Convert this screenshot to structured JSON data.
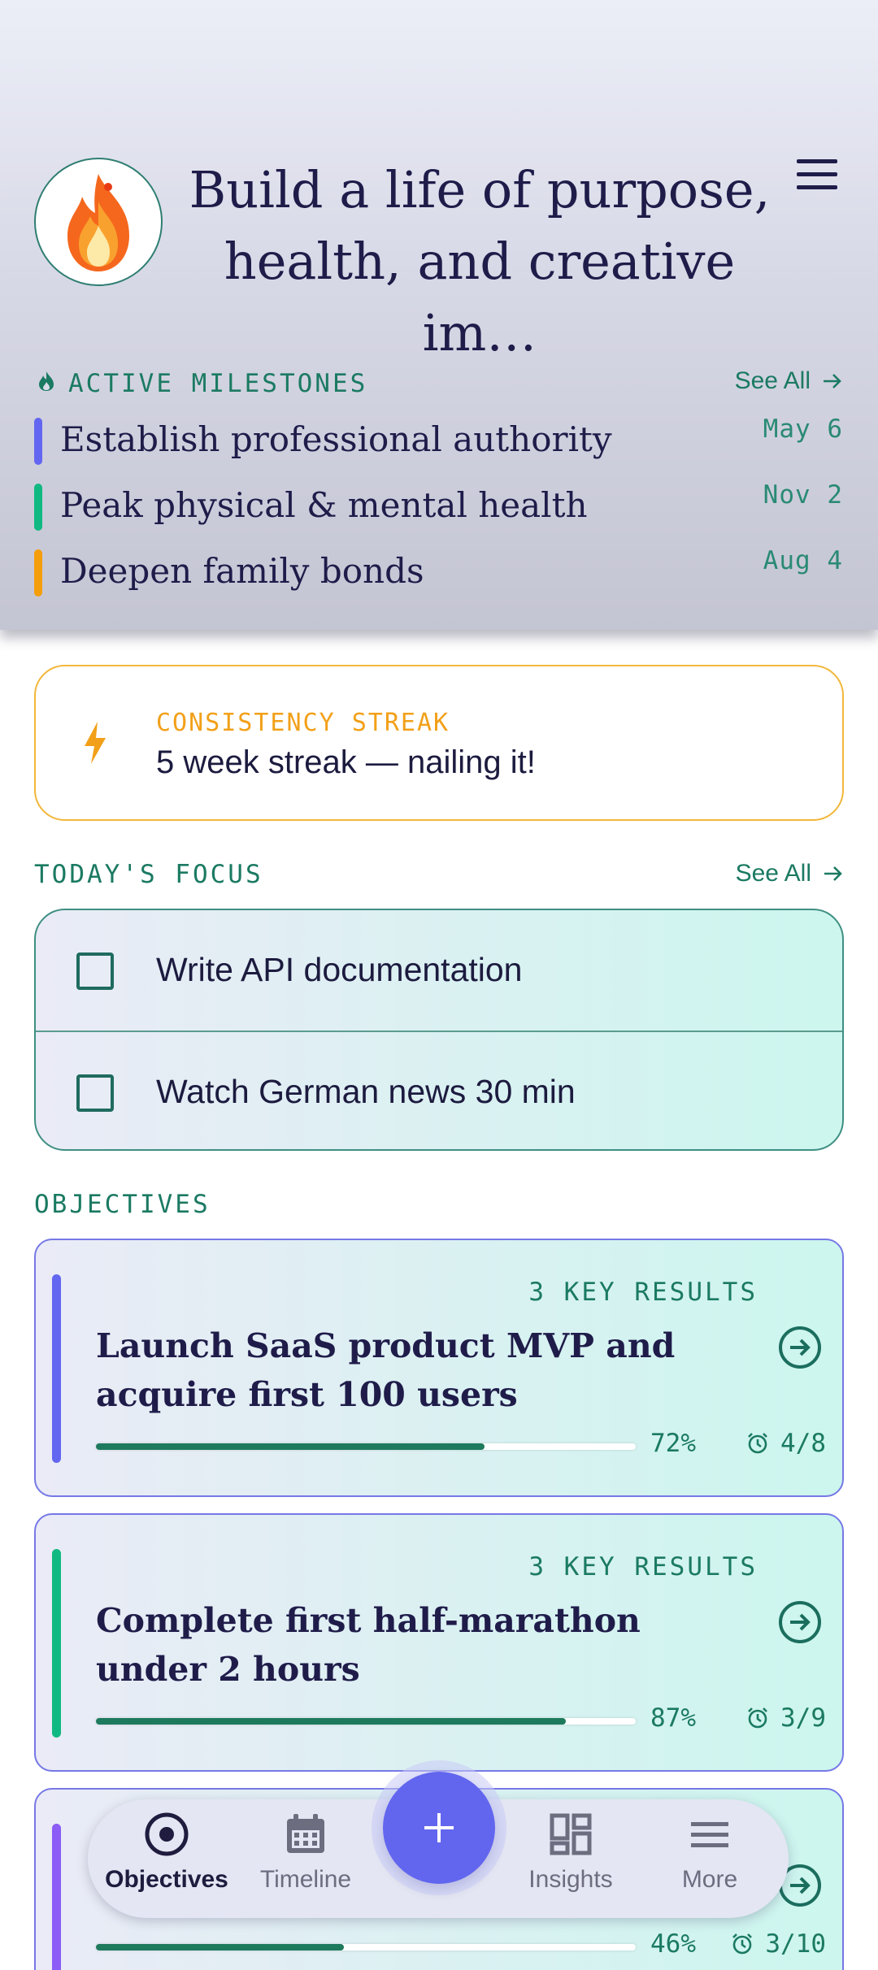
{
  "header": {
    "goal_title": "Build a life of purpose, health, and creative im…",
    "avatar_icon": "flame-icon",
    "menu_icon": "hamburger-menu-icon"
  },
  "milestones": {
    "label": "ACTIVE MILESTONES",
    "see_all": "See All",
    "items": [
      {
        "title": "Establish professional authority",
        "date": "May 6",
        "color": "#6366f1"
      },
      {
        "title": "Peak physical & mental health",
        "date": "Nov 2",
        "color": "#10b981"
      },
      {
        "title": "Deepen family bonds",
        "date": "Aug 4",
        "color": "#f59e0b"
      }
    ]
  },
  "streak": {
    "label": "CONSISTENCY STREAK",
    "text": "5 week streak — nailing it!",
    "icon": "lightning-icon",
    "color": "#f2a019"
  },
  "focus": {
    "label": "TODAY'S FOCUS",
    "see_all": "See All",
    "tasks": [
      {
        "text": "Write API documentation",
        "checked": false
      },
      {
        "text": "Watch German news 30 min",
        "checked": false
      }
    ]
  },
  "objectives": {
    "label": "OBJECTIVES",
    "items": [
      {
        "key_results": "3 KEY RESULTS",
        "title": "Launch SaaS product MVP and acquire first 100 users",
        "progress_pct": 72,
        "pct_label": "72%",
        "count": "4/8",
        "color": "#6366f1"
      },
      {
        "key_results": "3 KEY RESULTS",
        "title": "Complete first half-marathon under 2 hours",
        "progress_pct": 87,
        "pct_label": "87%",
        "count": "3/9",
        "color": "#10b981"
      },
      {
        "key_results": "",
        "title": "",
        "progress_pct": 46,
        "pct_label": "46%",
        "count": "3/10",
        "color": "#8b5cf6"
      }
    ]
  },
  "nav": {
    "items": [
      {
        "label": "Objectives",
        "icon": "target-icon",
        "active": true
      },
      {
        "label": "Timeline",
        "icon": "calendar-icon",
        "active": false
      },
      {
        "label": "Insights",
        "icon": "dashboard-icon",
        "active": false
      },
      {
        "label": "More",
        "icon": "menu-icon",
        "active": false
      }
    ],
    "fab_label": "+"
  }
}
